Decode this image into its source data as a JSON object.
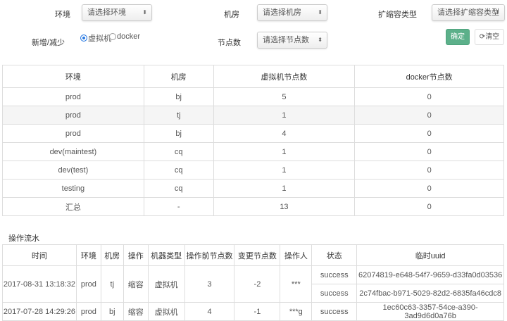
{
  "filters": {
    "env_label": "环境",
    "env_placeholder": "请选择环境",
    "room_label": "机房",
    "room_placeholder": "请选择机房",
    "scale_type_label": "扩缩容类型",
    "scale_type_placeholder": "请选择扩缩容类型",
    "change_label": "新增/减少",
    "radio_vm": "虚拟机",
    "radio_docker": "docker",
    "nodes_label": "节点数",
    "nodes_placeholder": "请选择节点数",
    "confirm": "确定",
    "clear": "清空"
  },
  "summary": {
    "headers": [
      "环境",
      "机房",
      "虚拟机节点数",
      "docker节点数"
    ],
    "rows": [
      [
        "prod",
        "bj",
        "5",
        "0"
      ],
      [
        "prod",
        "tj",
        "1",
        "0"
      ],
      [
        "prod",
        "bj",
        "4",
        "0"
      ],
      [
        "dev(maintest)",
        "cq",
        "1",
        "0"
      ],
      [
        "dev(test)",
        "cq",
        "1",
        "0"
      ],
      [
        "testing",
        "cq",
        "1",
        "0"
      ],
      [
        "汇总",
        "-",
        "13",
        "0"
      ]
    ]
  },
  "log": {
    "title": "操作流水",
    "headers": [
      "时间",
      "环境",
      "机房",
      "操作",
      "机器类型",
      "操作前节点数",
      "变更节点数",
      "操作人",
      "状态",
      "临时uuid"
    ],
    "rows": [
      {
        "time": "2017-08-31 13:18:32",
        "env": "prod",
        "room": "tj",
        "op": "缩容",
        "type": "虚拟机",
        "before": "3",
        "change": "-2",
        "user": "***",
        "items": [
          [
            "success",
            "62074819-e648-54f7-9659-d33fa0d03536"
          ],
          [
            "success",
            "2c74fbac-b971-5029-82d2-6835fa46cdc8"
          ]
        ]
      },
      {
        "time": "2017-07-28 14:29:26",
        "env": "prod",
        "room": "bj",
        "op": "缩容",
        "type": "虚拟机",
        "before": "4",
        "change": "-1",
        "user": "***g",
        "items": [
          [
            "success",
            "1ec60c63-3357-54ce-a390-3ad9d6d0a76b"
          ]
        ]
      }
    ]
  },
  "colors": {
    "confirm": "#5cb08a",
    "radio": "#2a7ae2"
  }
}
